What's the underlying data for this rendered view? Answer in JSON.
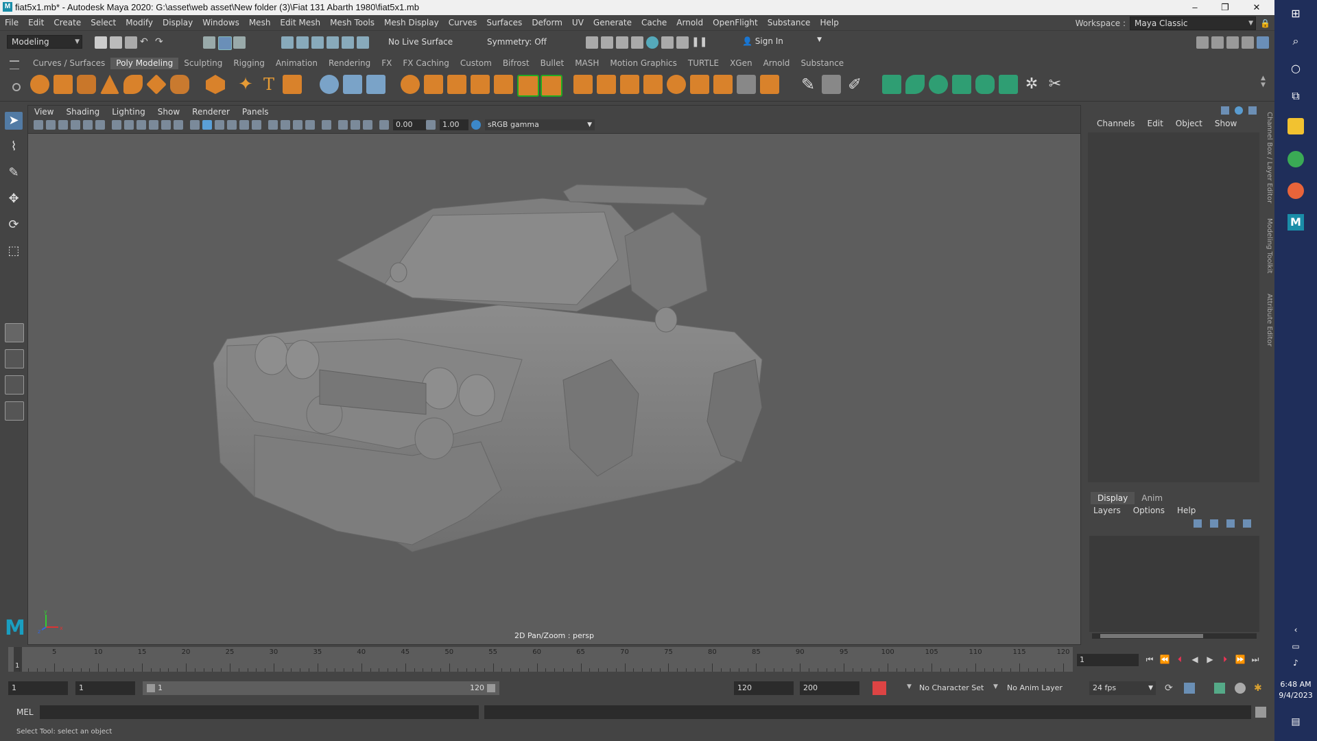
{
  "titlebar": {
    "title": "fiat5x1.mb* - Autodesk Maya 2020: G:\\asset\\web asset\\New folder (3)\\Fiat 131 Abarth 1980\\fiat5x1.mb",
    "min": "–",
    "max": "❐",
    "close": "✕"
  },
  "menubar": {
    "items": [
      "File",
      "Edit",
      "Create",
      "Select",
      "Modify",
      "Display",
      "Windows",
      "Mesh",
      "Edit Mesh",
      "Mesh Tools",
      "Mesh Display",
      "Curves",
      "Surfaces",
      "Deform",
      "UV",
      "Generate",
      "Cache",
      "Arnold",
      "OpenFlight",
      "Substance",
      "Help"
    ],
    "workspace_label": "Workspace :",
    "workspace_value": "Maya Classic"
  },
  "statusline": {
    "mode": "Modeling",
    "live_surface": "No Live Surface",
    "symmetry": "Symmetry: Off",
    "sign_in": "Sign In"
  },
  "shelf": {
    "tabs": [
      "Curves / Surfaces",
      "Poly Modeling",
      "Sculpting",
      "Rigging",
      "Animation",
      "Rendering",
      "FX",
      "FX Caching",
      "Custom",
      "Bifrost",
      "Bullet",
      "MASH",
      "Motion Graphics",
      "TURTLE",
      "XGen",
      "Arnold",
      "Substance"
    ],
    "active_tab": "Poly Modeling"
  },
  "viewport": {
    "menu": [
      "View",
      "Shading",
      "Lighting",
      "Show",
      "Renderer",
      "Panels"
    ],
    "exposure": "0.00",
    "gamma": "1.00",
    "colorspace": "sRGB gamma",
    "hud": "2D Pan/Zoom : persp",
    "axis": {
      "x": "x",
      "y": "y",
      "z": "z"
    }
  },
  "channelbox": {
    "menu": [
      "Channels",
      "Edit",
      "Object",
      "Show"
    ],
    "side_tabs": [
      "Channel Box / Layer Editor",
      "Modeling Toolkit",
      "Attribute Editor"
    ]
  },
  "layereditor": {
    "tabs": [
      "Display",
      "Anim"
    ],
    "active_tab": "Display",
    "menu": [
      "Layers",
      "Options",
      "Help"
    ]
  },
  "timeslider": {
    "labels": [
      "5",
      "10",
      "15",
      "20",
      "25",
      "30",
      "35",
      "40",
      "45",
      "50",
      "55",
      "60",
      "65",
      "70",
      "75",
      "80",
      "85",
      "90",
      "95",
      "100",
      "105",
      "110",
      "115",
      "120"
    ],
    "playhead": "1",
    "current_frame": "1"
  },
  "rangeslider": {
    "start": "1",
    "playback_start": "1",
    "range_start_label": "1",
    "range_end_label": "120",
    "playback_end": "120",
    "end": "200",
    "character_set": "No Character Set",
    "anim_layer": "No Anim Layer",
    "fps": "24 fps"
  },
  "cmdline": {
    "label": "MEL"
  },
  "helpline": {
    "text": "Select Tool: select an object"
  },
  "taskbar": {
    "time": "6:48 AM",
    "date": "9/4/2023"
  }
}
